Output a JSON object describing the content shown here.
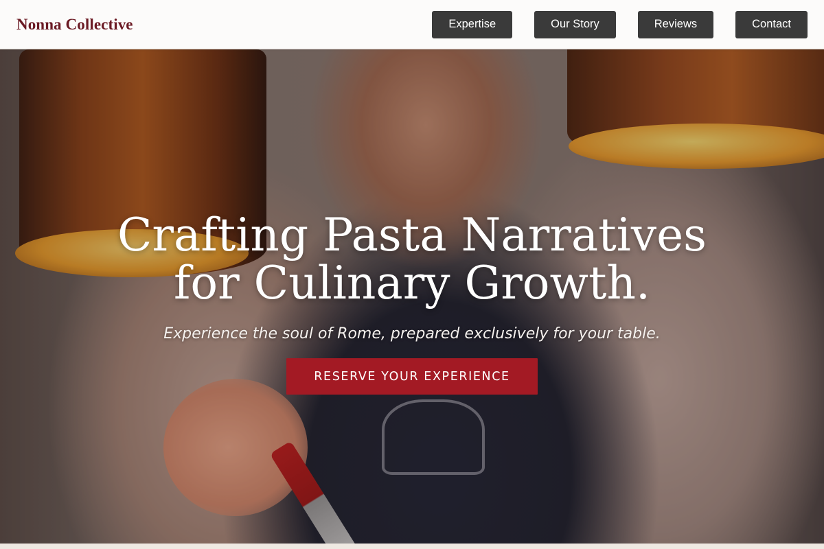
{
  "brand": {
    "name": "Nonna Collective"
  },
  "nav": {
    "items": [
      {
        "label": "Expertise"
      },
      {
        "label": "Our Story"
      },
      {
        "label": "Reviews"
      },
      {
        "label": "Contact"
      }
    ]
  },
  "hero": {
    "headline": "Crafting Pasta Narratives for Culinary Growth.",
    "subheadline": "Experience the soul of Rome, prepared exclusively for your table.",
    "cta_label": "RESERVE YOUR EXPERIENCE",
    "image_description_icon": "chef-photo"
  },
  "colors": {
    "brand": "#6b1a24",
    "nav_button": "#3a3a3a",
    "cta": "#a31a24"
  }
}
